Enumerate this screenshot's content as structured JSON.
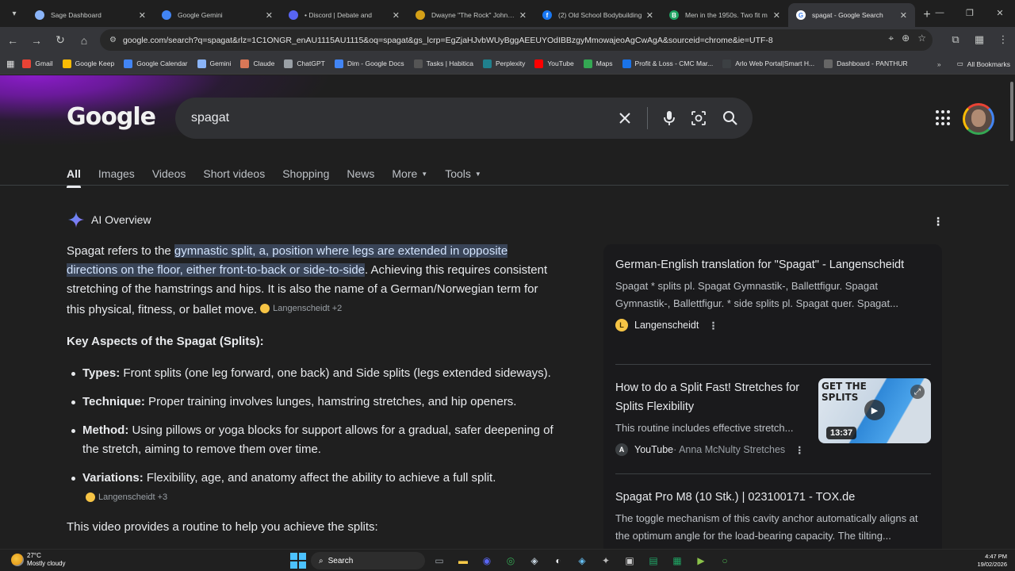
{
  "browser": {
    "tabs": [
      {
        "title": "Sage Dashboard",
        "icon": "globe-icon",
        "color": "#8ab4f8",
        "glyph": "",
        "active": false
      },
      {
        "title": "Google Gemini",
        "icon": "gemini-icon",
        "color": "#4285f4",
        "glyph": "",
        "active": false
      },
      {
        "title": "• Discord | Debate and",
        "icon": "discord-icon",
        "color": "#5865f2",
        "glyph": "",
        "active": false
      },
      {
        "title": "Dwayne \"The Rock\" Johnson",
        "icon": "figure-icon",
        "color": "#d4a017",
        "glyph": "",
        "active": false
      },
      {
        "title": "(2) Old School Bodybuilding",
        "icon": "facebook-icon",
        "color": "#1877f2",
        "glyph": "f",
        "active": false
      },
      {
        "title": "Men in the 1950s. Two fit m",
        "icon": "b-icon",
        "color": "#1fa463",
        "glyph": "B",
        "active": false
      },
      {
        "title": "spagat - Google Search",
        "icon": "google-icon",
        "color": "#ffffff",
        "glyph": "G",
        "active": true
      }
    ],
    "url": "google.com/search?q=spagat&rlz=1C1ONGR_enAU1115AU1115&oq=spagat&gs_lcrp=EgZjaHJvbWUyBggAEEUYOdIBBzgyMmowajeoAgCwAgA&sourceid=chrome&ie=UTF-8",
    "bookmarks": [
      {
        "label": "Gmail",
        "color": "#ea4335"
      },
      {
        "label": "Google Keep",
        "color": "#fbbc05"
      },
      {
        "label": "Google Calendar",
        "color": "#4285f4"
      },
      {
        "label": "Gemini",
        "color": "#8ab4f8"
      },
      {
        "label": "Claude",
        "color": "#d97757"
      },
      {
        "label": "ChatGPT",
        "color": "#9aa0a6"
      },
      {
        "label": "Dim - Google Docs",
        "color": "#4285f4"
      },
      {
        "label": "Tasks | Habitica",
        "color": "#555555"
      },
      {
        "label": "Perplexity",
        "color": "#20808d"
      },
      {
        "label": "YouTube",
        "color": "#ff0000"
      },
      {
        "label": "Maps",
        "color": "#34a853"
      },
      {
        "label": "Profit & Loss - CMC Mar...",
        "color": "#1a73e8"
      },
      {
        "label": "Arlo Web Portal|Smart H...",
        "color": "#3c4043"
      },
      {
        "label": "Dashboard - PANTHUR",
        "color": "#666666"
      }
    ],
    "all_bookmarks": "All Bookmarks"
  },
  "search": {
    "logo": "Google",
    "query": "spagat",
    "tabs": [
      "All",
      "Images",
      "Videos",
      "Short videos",
      "Shopping",
      "News",
      "More",
      "Tools"
    ]
  },
  "ai_overview": {
    "title": "AI Overview",
    "p_before": "Spagat refers to the ",
    "p_highlight": "gymnastic split, a, position where legs are extended in opposite directions on the floor, either front-to-back or side-to-side",
    "p_after": ". Achieving this requires consistent stretching of the hamstrings and hips. It is also the name of a German/Norwegian term for this physical, fitness, or ballet move.",
    "p_cite": "Langenscheidt +2",
    "key_heading": "Key Aspects of the Spagat (Splits):",
    "items": [
      {
        "term": "Types:",
        "text": " Front splits (one leg forward, one back) and Side splits (legs extended sideways).",
        "cite": ""
      },
      {
        "term": "Technique:",
        "text": " Proper training involves lunges, hamstring stretches, and hip openers.",
        "cite": ""
      },
      {
        "term": "Method:",
        "text": " Using pillows or yoga blocks for support allows for a gradual, safer deepening of the stretch, aiming to remove them over time.",
        "cite": ""
      },
      {
        "term": "Variations:",
        "text": " Flexibility, age, and anatomy affect the ability to achieve a full split.",
        "cite": "Langenscheidt +3"
      }
    ],
    "cutoff": "This video provides a routine to help you achieve the splits:"
  },
  "results": [
    {
      "title": "German-English translation for \"Spagat\" - Langenscheidt",
      "snippet": "Spagat * splits pl. Spagat Gymnastik-, Ballettfigur. Spagat Gymnastik-, Ballettfigur. * side splits pl. Spagat quer. Spagat...",
      "source": "Langenscheidt",
      "source_sub": ""
    },
    {
      "title": "How to do a Split Fast! Stretches for Splits Flexibility",
      "snippet": "This routine includes effective stretch...",
      "source": "YouTube",
      "source_sub": " · Anna McNulty Stretches",
      "thumb_text": "GET THE SPLITS",
      "duration": "13:37"
    },
    {
      "title": "Spagat Pro M8 (10 Stk.) | 023100171 - TOX.de",
      "snippet": "The toggle mechanism of this cavity anchor automatically aligns at the optimum angle for the load-bearing capacity. The tilting...",
      "source": "",
      "source_sub": ""
    }
  ],
  "taskbar": {
    "temp": "27°C",
    "weather": "Mostly cloudy",
    "search": "Search",
    "time": "4:47 PM",
    "date": "19/02/2026"
  }
}
